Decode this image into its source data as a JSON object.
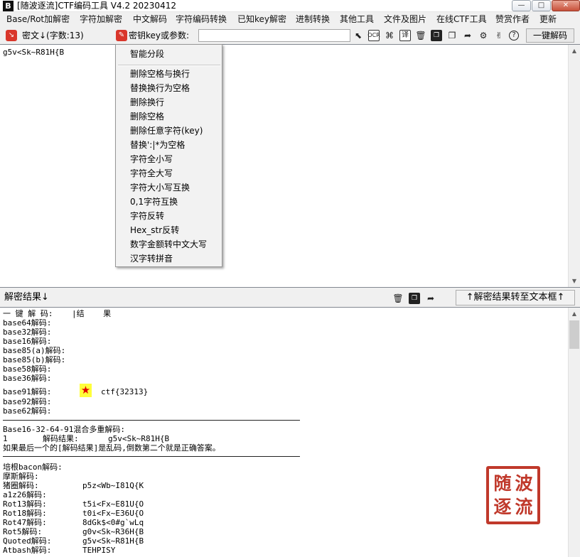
{
  "window": {
    "icon_text": "B",
    "title": "[随波逐流]CTF编码工具 V4.2 20230412",
    "minimize_label": "—",
    "maximize_label": "□",
    "close_label": "✕"
  },
  "menu": {
    "items": [
      "Base/Rot加解密",
      "字符加解密",
      "中文解码",
      "字符编码转换",
      "已知key解密",
      "进制转换",
      "其他工具",
      "文件及图片",
      "在线CTF工具",
      "赞赏作者",
      "更新"
    ]
  },
  "toolbar": {
    "cipher_label": "密文↓(字数:13)",
    "key_label": "密钥key或参数:",
    "key_value": "",
    "ocr_label": "OCR",
    "decode_button": "一键解码"
  },
  "cipher": {
    "text": "g5v<Sk~R81H{B"
  },
  "context_menu": {
    "items": [
      "智能分段",
      "删除空格与换行",
      "替换换行为空格",
      "删除换行",
      "删除空格",
      "删除任意字符(key)",
      "替换':|*为空格",
      "字符全小写",
      "字符全大写",
      "字符大小写互换",
      "0,1字符互换",
      "字符反转",
      "Hex_str反转",
      "数字金额转中文大写",
      "汉字转拼音"
    ]
  },
  "result_header": {
    "label": "解密结果↓",
    "to_text_button": "↑解密结果转至文本框↑"
  },
  "results": {
    "header_line": "一 键 解 码:    |结    果",
    "base_lines": [
      {
        "label": "base64解码:",
        "value": ""
      },
      {
        "label": "base32解码:",
        "value": ""
      },
      {
        "label": "base16解码:",
        "value": ""
      },
      {
        "label": "base85(a)解码:",
        "value": ""
      },
      {
        "label": "base85(b)解码:",
        "value": ""
      },
      {
        "label": "base58解码:",
        "value": ""
      },
      {
        "label": "base36解码:",
        "value": ""
      },
      {
        "label": "base91解码:",
        "value": "ctf{32313}"
      },
      {
        "label": "base92解码:",
        "value": ""
      },
      {
        "label": "base62解码:",
        "value": ""
      }
    ],
    "star_mark": "★",
    "mixed_title": "Base16-32-64-91混合多重解码:",
    "mixed_index": "1",
    "mixed_label": "解码结果:",
    "mixed_value": "g5v<Sk~R81H{B",
    "mixed_note": "如果最后一个的[解码结果]是乱码,倒数第二个就是正确答案。",
    "other_lines": [
      {
        "label": "培根bacon解码:",
        "value": ""
      },
      {
        "label": "摩斯解码:",
        "value": ""
      },
      {
        "label": "猪圈解码:",
        "value": "p5z<Wb~I81Q{K"
      },
      {
        "label": "a1z26解码:",
        "value": ""
      },
      {
        "label": "Rot13解码:",
        "value": "t5i<Fx~E81U{O"
      },
      {
        "label": "Rot18解码:",
        "value": "t0i<Fx~E36U{O"
      },
      {
        "label": "Rot47解码:",
        "value": "8dGk$<0#g`wLq"
      },
      {
        "label": "Rot5解码:",
        "value": "g0v<Sk~R36H{B"
      },
      {
        "label": "Quoted解码:",
        "value": "g5v<Sk~R81H{B"
      },
      {
        "label": "Atbash解码:",
        "value": "TEHPISY"
      }
    ],
    "stamp_chars": [
      "随",
      "波",
      "逐",
      "流"
    ]
  },
  "colors": {
    "stamp": "#c0392b",
    "star": "#e00000",
    "star_bg": "#ffff3a"
  }
}
